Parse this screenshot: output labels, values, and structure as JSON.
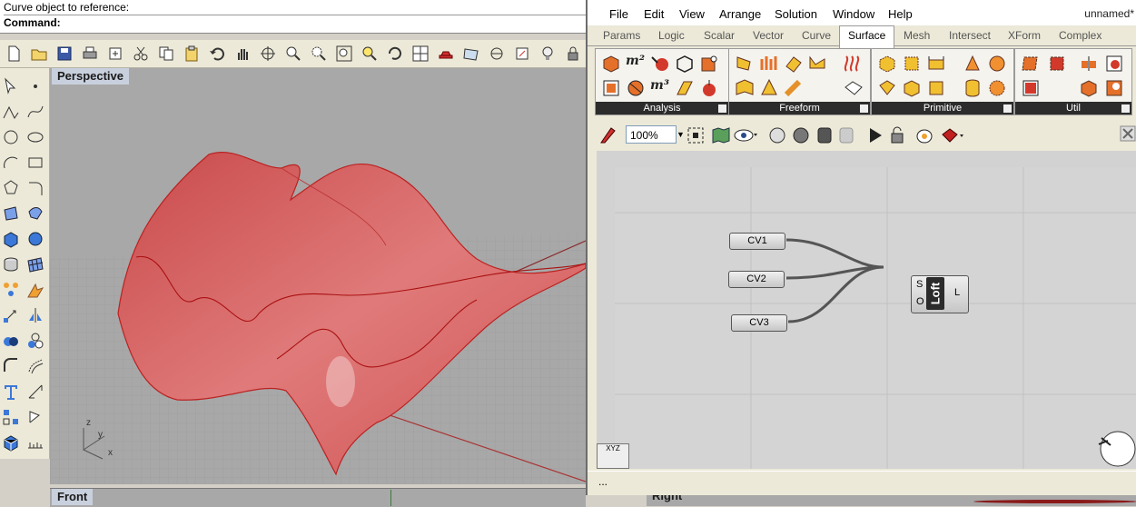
{
  "command": {
    "prompt": "Curve object to reference:",
    "input_label": "Command:"
  },
  "rhino": {
    "viewport_label": "Perspective",
    "front_label": "Front",
    "right_label": "Right",
    "axis_labels": {
      "z": "z",
      "y": "y",
      "x": "x"
    },
    "surface_color": "#d94b4b"
  },
  "grasshopper": {
    "menus": [
      "File",
      "Edit",
      "View",
      "Arrange",
      "Solution",
      "Window",
      "Help"
    ],
    "title": "unnamed*",
    "tabs": [
      "Params",
      "Logic",
      "Scalar",
      "Vector",
      "Curve",
      "Surface",
      "Mesh",
      "Intersect",
      "XForm",
      "Complex"
    ],
    "active_tab": "Surface",
    "ribbon_groups": [
      "Analysis",
      "Freeform",
      "Primitive",
      "Util"
    ],
    "zoom": "100%",
    "params": [
      "CV1",
      "CV2",
      "CV3"
    ],
    "component": {
      "name": "Loft",
      "inputs": [
        "S",
        "O"
      ],
      "output": "L"
    },
    "status_text": "...",
    "compass_label": "XYZ"
  }
}
